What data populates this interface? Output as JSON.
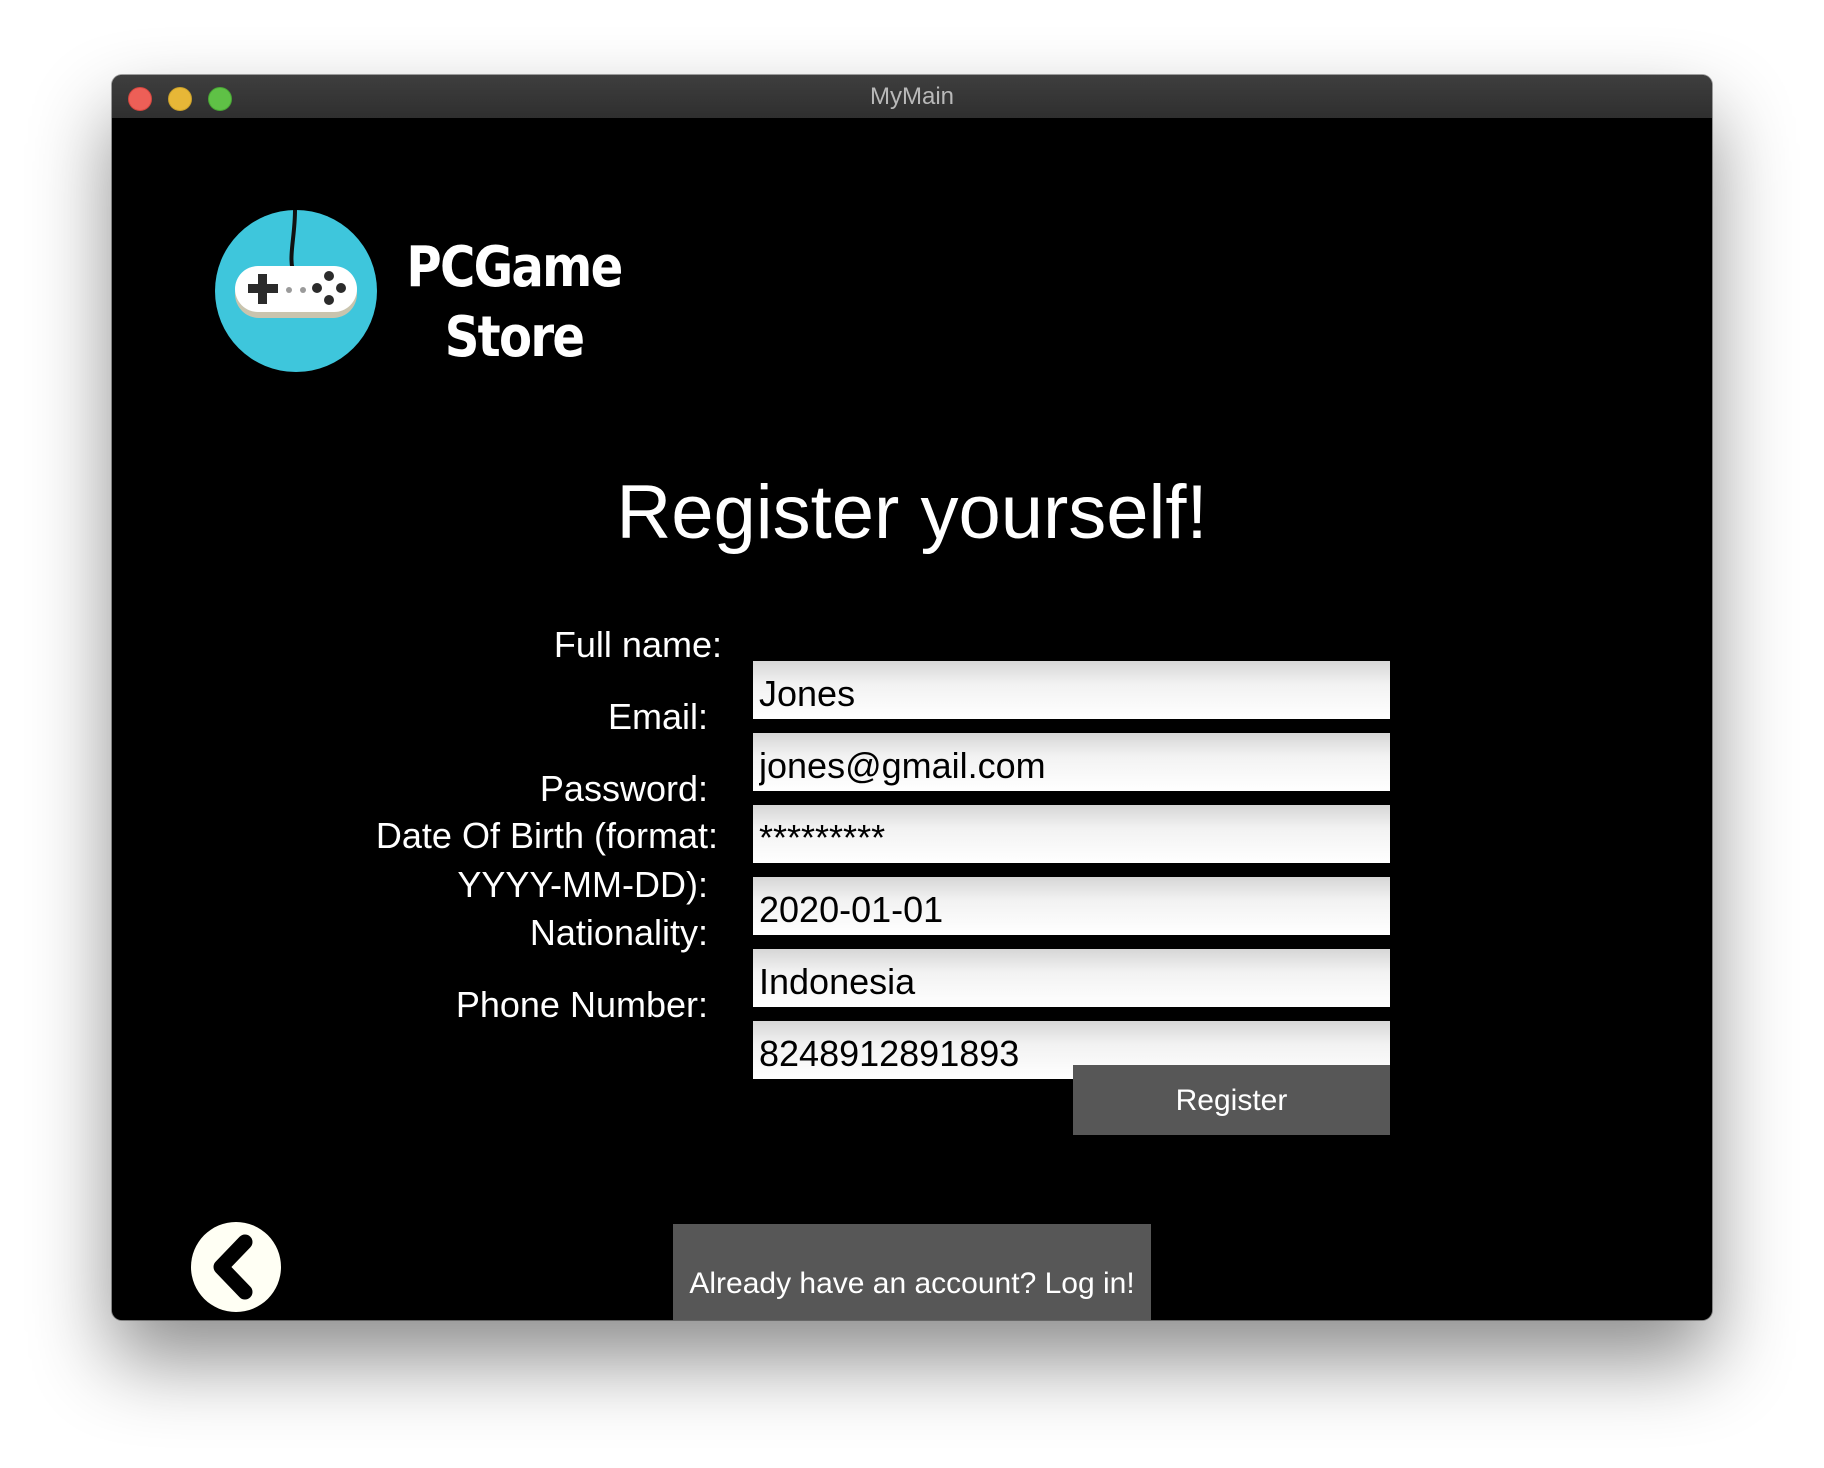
{
  "window": {
    "title": "MyMain"
  },
  "brand": {
    "line1": "PCGame",
    "line2": "Store",
    "logo_icon": "gamepad-icon",
    "logo_color": "#3ec6dc"
  },
  "heading": "Register yourself!",
  "form": {
    "full_name": {
      "label": "Full name:",
      "value": "Jones"
    },
    "email": {
      "label": "Email:",
      "value": "jones@gmail.com"
    },
    "password": {
      "label": "Password:",
      "value": "*********"
    },
    "dob": {
      "label_line1": "Date Of Birth (format:",
      "label_line2": "YYYY-MM-DD):",
      "value": "2020-01-01"
    },
    "nationality": {
      "label": "Nationality:",
      "value": "Indonesia"
    },
    "phone": {
      "label": "Phone Number:",
      "value": "8248912891893"
    }
  },
  "buttons": {
    "register": "Register",
    "login": "Already have an account? Log in!",
    "back_icon": "chevron-left-icon"
  },
  "colors": {
    "background": "#000000",
    "button": "#575757",
    "text": "#ffffff"
  }
}
